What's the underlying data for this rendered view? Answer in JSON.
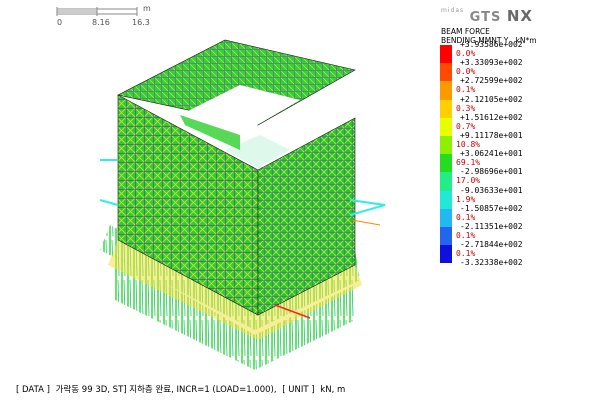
{
  "scale_bar": {
    "ticks": [
      "0",
      "8.16",
      "16.3"
    ],
    "unit": "m"
  },
  "brand": {
    "small": "midas",
    "name": "GTS",
    "suffix": "NX"
  },
  "legend": {
    "title_line1": "BEAM FORCE",
    "title_line2": "BENDING MMNT Y , kN*m",
    "values": [
      "+3.93586e+002",
      "+3.33093e+002",
      "+2.72599e+002",
      "+2.12105e+002",
      "+1.51612e+002",
      "+9.11178e+001",
      "+3.06241e+001",
      "-2.98696e+001",
      "-9.03633e+001",
      "-1.50857e+002",
      "-2.11351e+002",
      "-2.71844e+002",
      "-3.32338e+002"
    ],
    "percents": [
      "0.0%",
      "0.0%",
      "0.1%",
      "0.3%",
      "0.7%",
      "10.8%",
      "69.1%",
      "17.0%",
      "1.9%",
      "0.1%",
      "0.1%",
      "0.1%"
    ],
    "colors": [
      "#ff0000",
      "#ff4a00",
      "#ff9900",
      "#ffd000",
      "#e8ff00",
      "#8cf000",
      "#22dd22",
      "#22ee88",
      "#22e8d8",
      "#22b8f0",
      "#2266ee",
      "#1010dd"
    ]
  },
  "status": {
    "data_label": "[ DATA ]",
    "data_value": "가락동 99 3D, ST] 지하층 완료, INCR=1 (LOAD=1.000),",
    "unit_label": "[ UNIT ]",
    "unit_value": "kN, m"
  }
}
